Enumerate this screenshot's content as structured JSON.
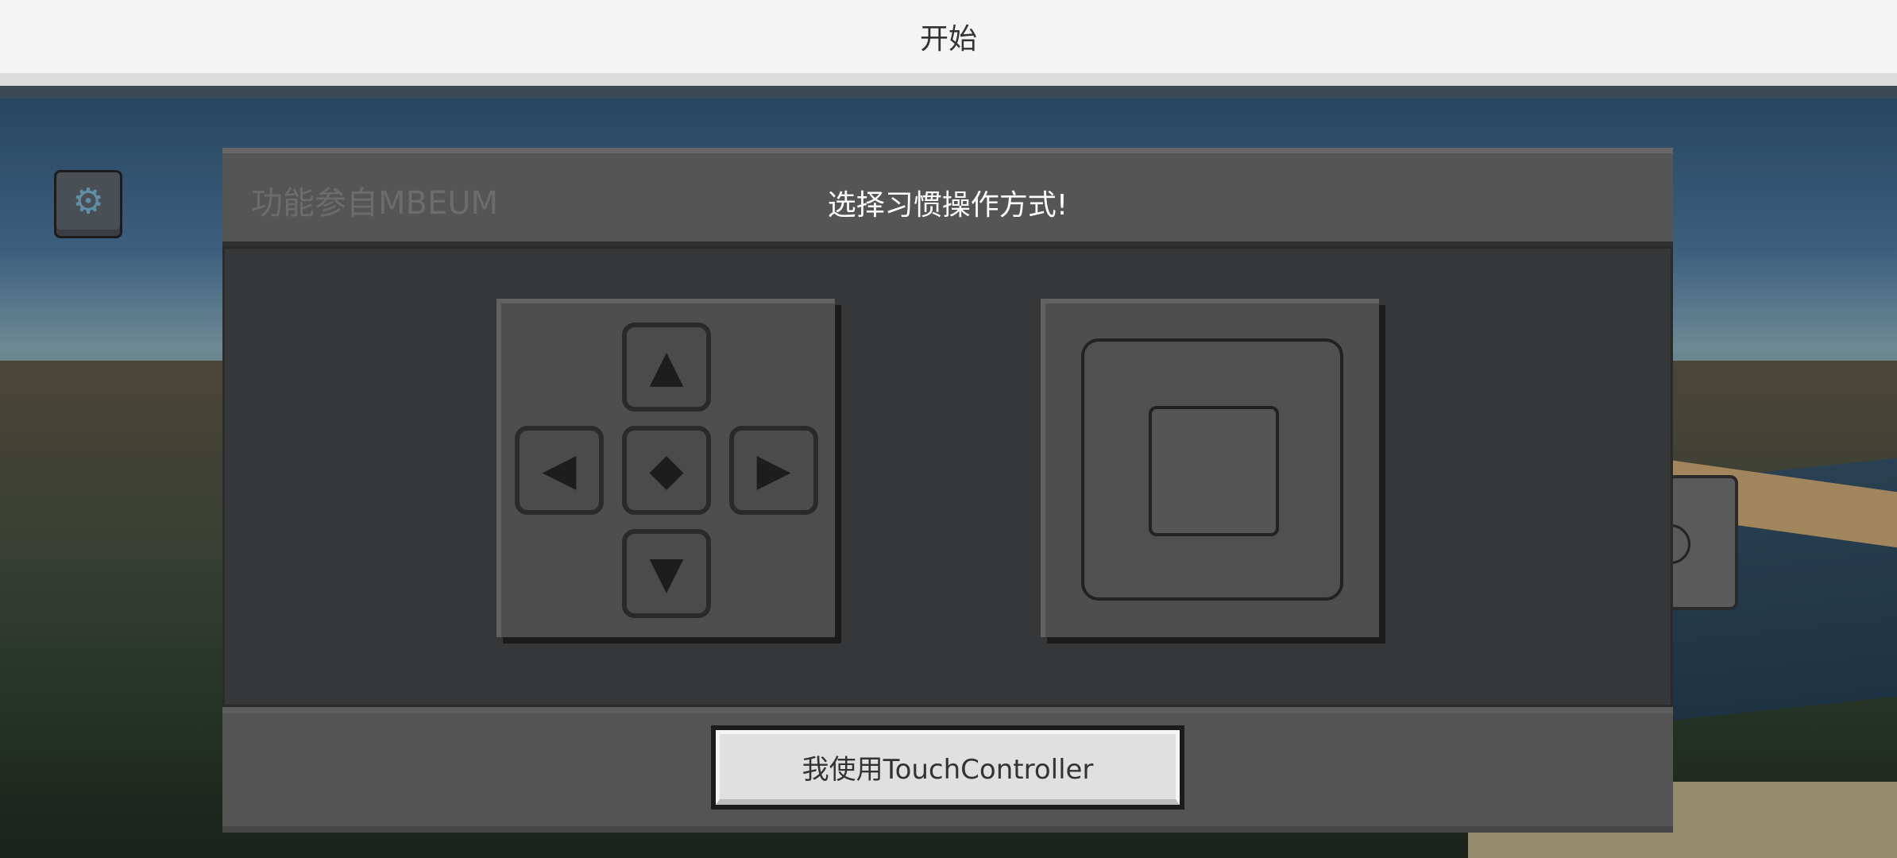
{
  "topbar": {
    "title": "开始"
  },
  "dialog": {
    "credit": "功能参自MBEUM",
    "heading": "选择习惯操作方式!",
    "options": [
      {
        "name": "dpad",
        "icons": [
          "up-arrow-icon",
          "left-arrow-icon",
          "center-diamond-icon",
          "right-arrow-icon",
          "down-arrow-icon"
        ]
      },
      {
        "name": "joystick"
      }
    ],
    "confirm_label": "我使用TouchController"
  },
  "glyphs": {
    "up": "▲",
    "left": "◀",
    "center": "◆",
    "right": "▶",
    "down": "▼",
    "gear": "⚙"
  }
}
